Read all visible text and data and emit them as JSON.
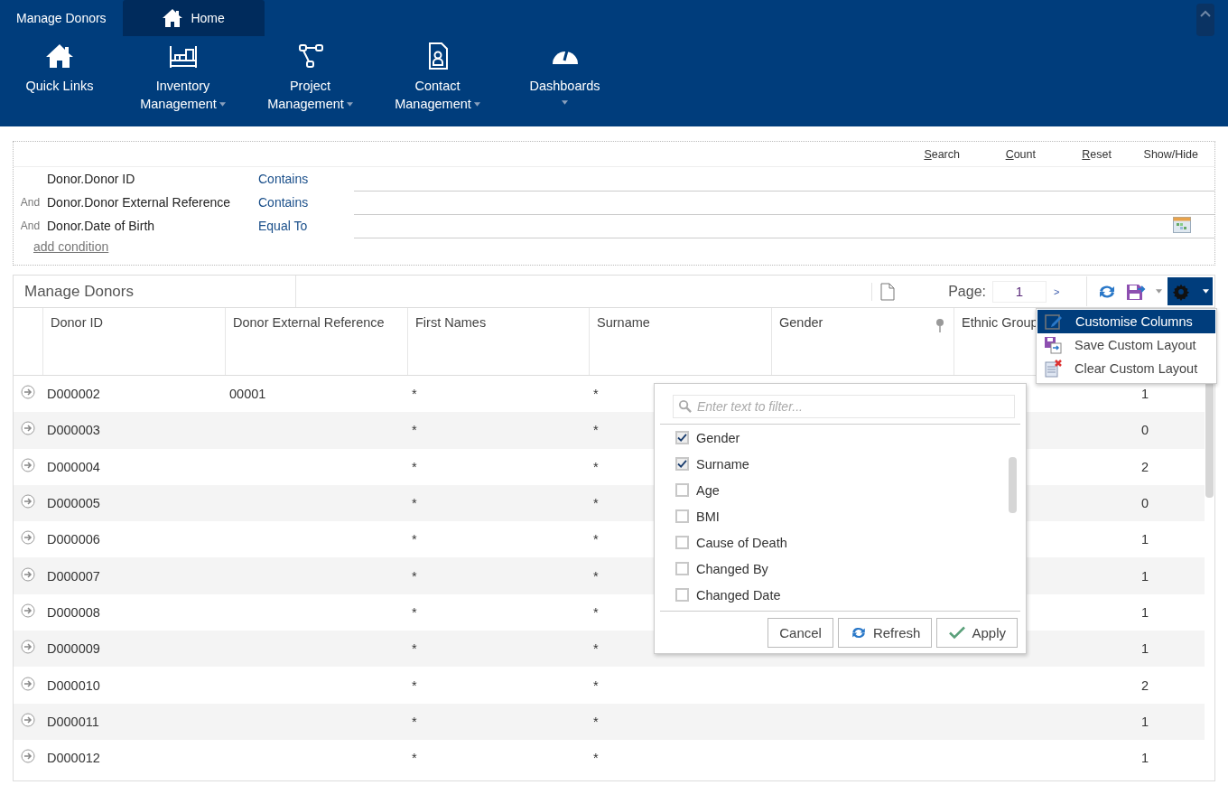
{
  "app_tabs": [
    {
      "label": "Manage Donors",
      "kind": "plain",
      "selected": false
    },
    {
      "label": "Home",
      "kind": "home",
      "selected": true
    }
  ],
  "ribbon": [
    {
      "lines": [
        "Quick Links"
      ],
      "kind": "home",
      "dropdown": false
    },
    {
      "lines": [
        "Inventory",
        "Management"
      ],
      "kind": "shelves",
      "dropdown": true
    },
    {
      "lines": [
        "Project",
        "Management"
      ],
      "kind": "nodes",
      "dropdown": true
    },
    {
      "lines": [
        "Contact",
        "Management"
      ],
      "kind": "contact",
      "dropdown": true
    },
    {
      "lines": [
        "Dashboards"
      ],
      "kind": "gauge",
      "dropdown": true
    }
  ],
  "filter": {
    "actions": [
      {
        "label": "Search",
        "accel": true
      },
      {
        "label": "Count",
        "accel": true
      },
      {
        "label": "Reset",
        "accel": true
      },
      {
        "label": "Show/Hide",
        "accel": false
      }
    ],
    "conditions": [
      {
        "field": "Donor.Donor ID",
        "operator": "Contains",
        "calendar": false
      },
      {
        "joiner": "And",
        "field": "Donor.Donor External Reference",
        "operator": "Contains",
        "calendar": false
      },
      {
        "joiner": "And",
        "field": "Donor.Date of Birth",
        "operator": "Equal To",
        "calendar": true
      }
    ],
    "add_link": "add condition"
  },
  "grid": {
    "title": "Manage Donors",
    "page_label": "Page:",
    "page_value": "1",
    "next": ">",
    "columns": [
      {
        "label": "Donor ID",
        "pin": false
      },
      {
        "label": "Donor External Reference",
        "pin": false
      },
      {
        "label": "First Names",
        "pin": false
      },
      {
        "label": "Surname",
        "pin": false
      },
      {
        "label": "Gender",
        "pin": true
      },
      {
        "label": "Ethnic Group",
        "pin": false
      }
    ],
    "rows": [
      {
        "cells": [
          "D000002",
          "00001",
          "*",
          "*",
          "1"
        ]
      },
      {
        "cells": [
          "D000003",
          "",
          "*",
          "*",
          "0"
        ]
      },
      {
        "cells": [
          "D000004",
          "",
          "*",
          "*",
          "2"
        ]
      },
      {
        "cells": [
          "D000005",
          "",
          "*",
          "*",
          "0"
        ]
      },
      {
        "cells": [
          "D000006",
          "",
          "*",
          "*",
          "1"
        ]
      },
      {
        "cells": [
          "D000007",
          "",
          "*",
          "*",
          "1"
        ]
      },
      {
        "cells": [
          "D000008",
          "",
          "*",
          "*",
          "1"
        ]
      },
      {
        "cells": [
          "D000009",
          "",
          "*",
          "*",
          "1"
        ]
      },
      {
        "cells": [
          "D000010",
          "",
          "*",
          "*",
          "2"
        ]
      },
      {
        "cells": [
          "D000011",
          "",
          "*",
          "*",
          "1"
        ]
      },
      {
        "cells": [
          "D000012",
          "",
          "*",
          "*",
          "1"
        ]
      }
    ]
  },
  "settings_menu": [
    {
      "label": "Customise Columns",
      "kind": "edit",
      "selected": true
    },
    {
      "label": "Save Custom Layout",
      "kind": "save",
      "selected": false
    },
    {
      "label": "Clear Custom Layout",
      "kind": "clear",
      "selected": false
    }
  ],
  "column_chooser": {
    "placeholder": "Enter text to filter...",
    "items": [
      {
        "label": "Gender",
        "checked": true
      },
      {
        "label": "Surname",
        "checked": true
      },
      {
        "label": "Age",
        "checked": false
      },
      {
        "label": "BMI",
        "checked": false
      },
      {
        "label": "Cause of Death",
        "checked": false
      },
      {
        "label": "Changed By",
        "checked": false
      },
      {
        "label": "Changed Date",
        "checked": false
      }
    ],
    "buttons": [
      {
        "label": "Cancel",
        "kind": "plain"
      },
      {
        "label": "Refresh",
        "kind": "refresh"
      },
      {
        "label": "Apply",
        "kind": "check"
      }
    ]
  }
}
